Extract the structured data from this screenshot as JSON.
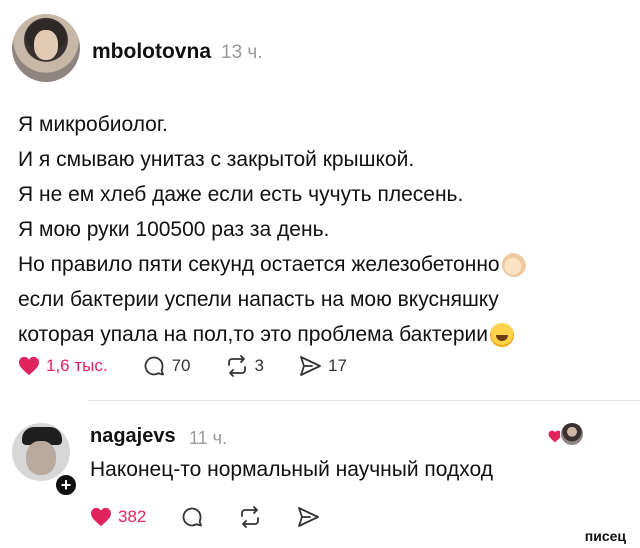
{
  "post": {
    "username": "mbolotovna",
    "time": "13 ч.",
    "lines": [
      "Я микробиолог.",
      "И я смываю унитаз с закрытой крышкой.",
      "Я не ем хлеб даже если есть чучуть плесень.",
      "Я мою руки 100500 раз за день.",
      "Но правило пяти секунд остается железобетонно",
      "если бактерии успели напасть на мою вкусняшку",
      "которая упала на пол,то это проблема бактерии"
    ],
    "emojis": [
      "hand-emoji",
      "laughing-emoji"
    ],
    "actions": {
      "likes": "1,6 тыс.",
      "comments": "70",
      "reposts": "3",
      "shares": "17"
    }
  },
  "reply": {
    "username": "nagajevs",
    "time": "11 ч.",
    "text": "Наконец-то нормальный научный подход",
    "actions": {
      "likes": "382"
    }
  },
  "watermark": "писец",
  "colors": {
    "like": "#e0245e",
    "text": "#111111",
    "muted": "#999999",
    "divider": "#e3e3e3"
  },
  "icons": [
    "heart-icon",
    "comment-icon",
    "repost-icon",
    "share-icon",
    "add-icon"
  ]
}
